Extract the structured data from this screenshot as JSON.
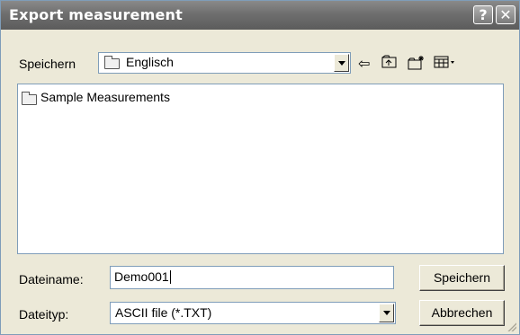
{
  "window": {
    "title": "Export measurement",
    "help_button": "?",
    "close_button": "✕"
  },
  "toolbar": {
    "save_in_label": "Speichern",
    "current_folder": "Englisch",
    "icons": [
      "back-icon",
      "up-folder-icon",
      "new-folder-icon",
      "view-menu-icon"
    ]
  },
  "file_list": {
    "items": [
      {
        "name": "Sample Measurements",
        "type": "folder"
      }
    ]
  },
  "filename": {
    "label": "Dateiname:",
    "value": "Demo001"
  },
  "filetype": {
    "label": "Dateityp:",
    "value": "ASCII file (*.TXT)"
  },
  "buttons": {
    "save": "Speichern",
    "cancel": "Abbrechen"
  }
}
